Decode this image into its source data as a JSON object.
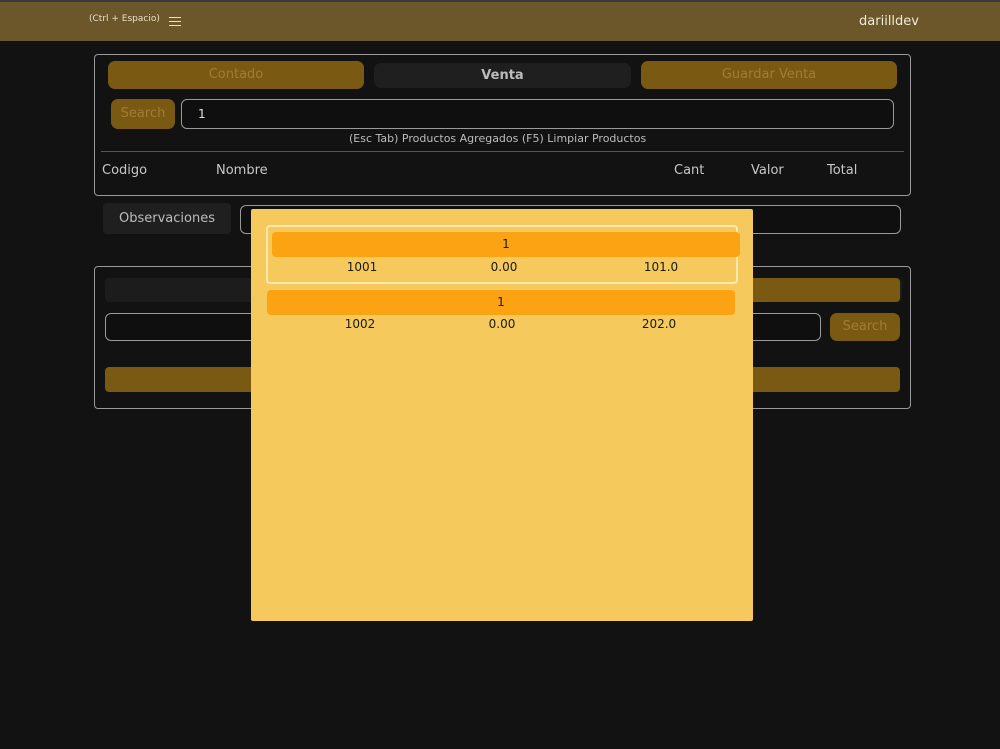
{
  "header": {
    "shortcut": "(Ctrl + Espacio)",
    "user": "dariilldev"
  },
  "sale": {
    "contado_label": "Contado",
    "venta_label": "Venta",
    "guardar_label": "Guardar Venta",
    "search_label": "Search",
    "search_value": "1",
    "hint": "(Esc Tab) Productos Agregados (F5) Limpiar Productos",
    "columns": [
      "Codigo",
      "Nombre",
      "Cant",
      "Valor",
      "Total"
    ]
  },
  "observaciones": {
    "label": "Observaciones",
    "value": ""
  },
  "lower": {
    "search_label": "Search",
    "input_value": ""
  },
  "results": [
    {
      "name": "1",
      "code": "1001",
      "qty": "0.00",
      "price": "101.0"
    },
    {
      "name": "1",
      "code": "1002",
      "qty": "0.00",
      "price": "202.0"
    }
  ],
  "colors": {
    "header_bg": "#6b5729",
    "accent": "#fca314",
    "modal_bg": "#f5c95c",
    "background": "#121212"
  }
}
